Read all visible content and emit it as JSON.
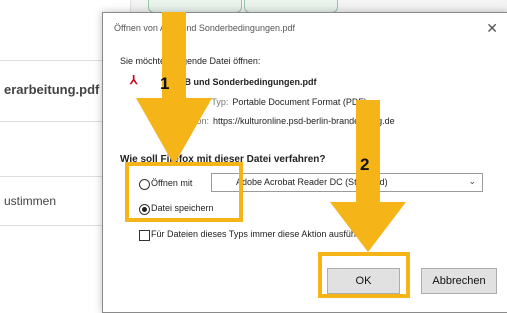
{
  "background": {
    "row1_text": "erarbeitung.pdf",
    "row2_text": "ustimmen"
  },
  "dialog": {
    "title": "Öffnen von AGB und Sonderbedingungen.pdf",
    "prompt": "Sie möchten folgende Datei öffnen:",
    "filename": "AGB und Sonderbedingungen.pdf",
    "type_label": "Vom Typ:",
    "type_value": "Portable Document Format (PDF)",
    "from_label": "Von:",
    "from_value": "https://kulturonline.psd-berlin-brandenburg.de",
    "question": "Wie soll Firefox mit dieser Datei verfahren?",
    "open_with_label": "Öffnen mit",
    "open_with_app": "Adobe Acrobat Reader DC (Standard)",
    "save_file_label": "Datei speichern",
    "remember_label": "Für Dateien dieses Typs immer diese Aktion ausführen",
    "ok_label": "OK",
    "cancel_label": "Abbrechen",
    "open_with_selected": false,
    "save_file_selected": true,
    "remember_checked": false
  },
  "annotations": {
    "step1": "1",
    "step2": "2",
    "color": "#f5b417"
  }
}
